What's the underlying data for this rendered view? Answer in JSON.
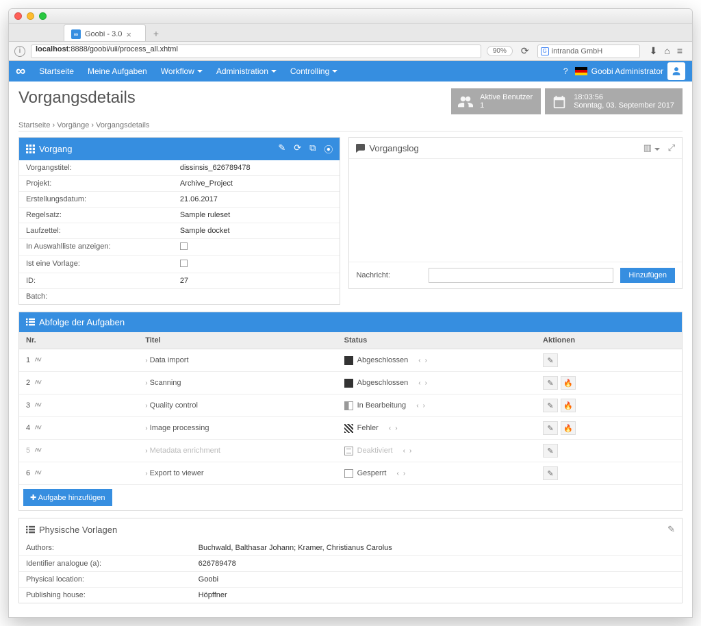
{
  "browser": {
    "tab_title": "Goobi - 3.0",
    "url_host": "localhost",
    "url_path": ":8888/goobi/uii/process_all.xhtml",
    "zoom": "90%",
    "search_placeholder": "intranda GmbH"
  },
  "nav": {
    "items": [
      "Startseite",
      "Meine Aufgaben",
      "Workflow",
      "Administration",
      "Controlling"
    ],
    "user": "Goobi Administrator"
  },
  "header": {
    "title": "Vorgangsdetails",
    "widget_users_label": "Aktive Benutzer",
    "widget_users_count": "1",
    "widget_time": "18:03:56",
    "widget_date": "Sonntag, 03. September 2017"
  },
  "breadcrumb": [
    "Startseite",
    "Vorgänge",
    "Vorgangsdetails"
  ],
  "panel_vorgang": {
    "title": "Vorgang",
    "rows": [
      {
        "k": "Vorgangstitel:",
        "v": "dissinsis_626789478"
      },
      {
        "k": "Projekt:",
        "v": "Archive_Project"
      },
      {
        "k": "Erstellungsdatum:",
        "v": "21.06.2017"
      },
      {
        "k": "Regelsatz:",
        "v": "Sample ruleset"
      },
      {
        "k": "Laufzettel:",
        "v": "Sample docket"
      }
    ],
    "checkbox_rows": [
      {
        "k": "In Auswahlliste anzeigen:"
      },
      {
        "k": "Ist eine Vorlage:"
      }
    ],
    "muted_rows": [
      {
        "k": "ID:",
        "v": "27"
      },
      {
        "k": "Batch:",
        "v": ""
      }
    ]
  },
  "panel_log": {
    "title": "Vorgangslog",
    "message_label": "Nachricht:",
    "add_button": "Hinzufügen"
  },
  "tasks": {
    "title": "Abfolge der Aufgaben",
    "columns": {
      "nr": "Nr.",
      "title": "Titel",
      "status": "Status",
      "actions": "Aktionen"
    },
    "rows": [
      {
        "nr": "1",
        "title": "Data import",
        "status": "Abgeschlossen",
        "status_class": "st-done",
        "actions": [
          "edit"
        ]
      },
      {
        "nr": "2",
        "title": "Scanning",
        "status": "Abgeschlossen",
        "status_class": "st-done",
        "actions": [
          "edit",
          "flame"
        ]
      },
      {
        "nr": "3",
        "title": "Quality control",
        "status": "In Bearbeitung",
        "status_class": "st-prog",
        "actions": [
          "edit",
          "flame"
        ]
      },
      {
        "nr": "4",
        "title": "Image processing",
        "status": "Fehler",
        "status_class": "st-err",
        "actions": [
          "edit",
          "flame"
        ]
      },
      {
        "nr": "5",
        "title": "Metadata enrichment",
        "status": "Deaktiviert",
        "status_class": "st-off",
        "disabled": true,
        "actions": [
          "edit"
        ]
      },
      {
        "nr": "6",
        "title": "Export to viewer",
        "status": "Gesperrt",
        "status_class": "st-lock",
        "actions": [
          "edit"
        ]
      }
    ],
    "add_button": "Aufgabe hinzufügen"
  },
  "phys": {
    "title": "Physische Vorlagen",
    "rows": [
      {
        "k": "Authors:",
        "v": "Buchwald, Balthasar Johann; Kramer, Christianus Carolus"
      },
      {
        "k": "Identifier analogue (a):",
        "v": "626789478"
      },
      {
        "k": "Physical location:",
        "v": "Goobi"
      },
      {
        "k": "Publishing house:",
        "v": "Höpffner"
      }
    ]
  }
}
